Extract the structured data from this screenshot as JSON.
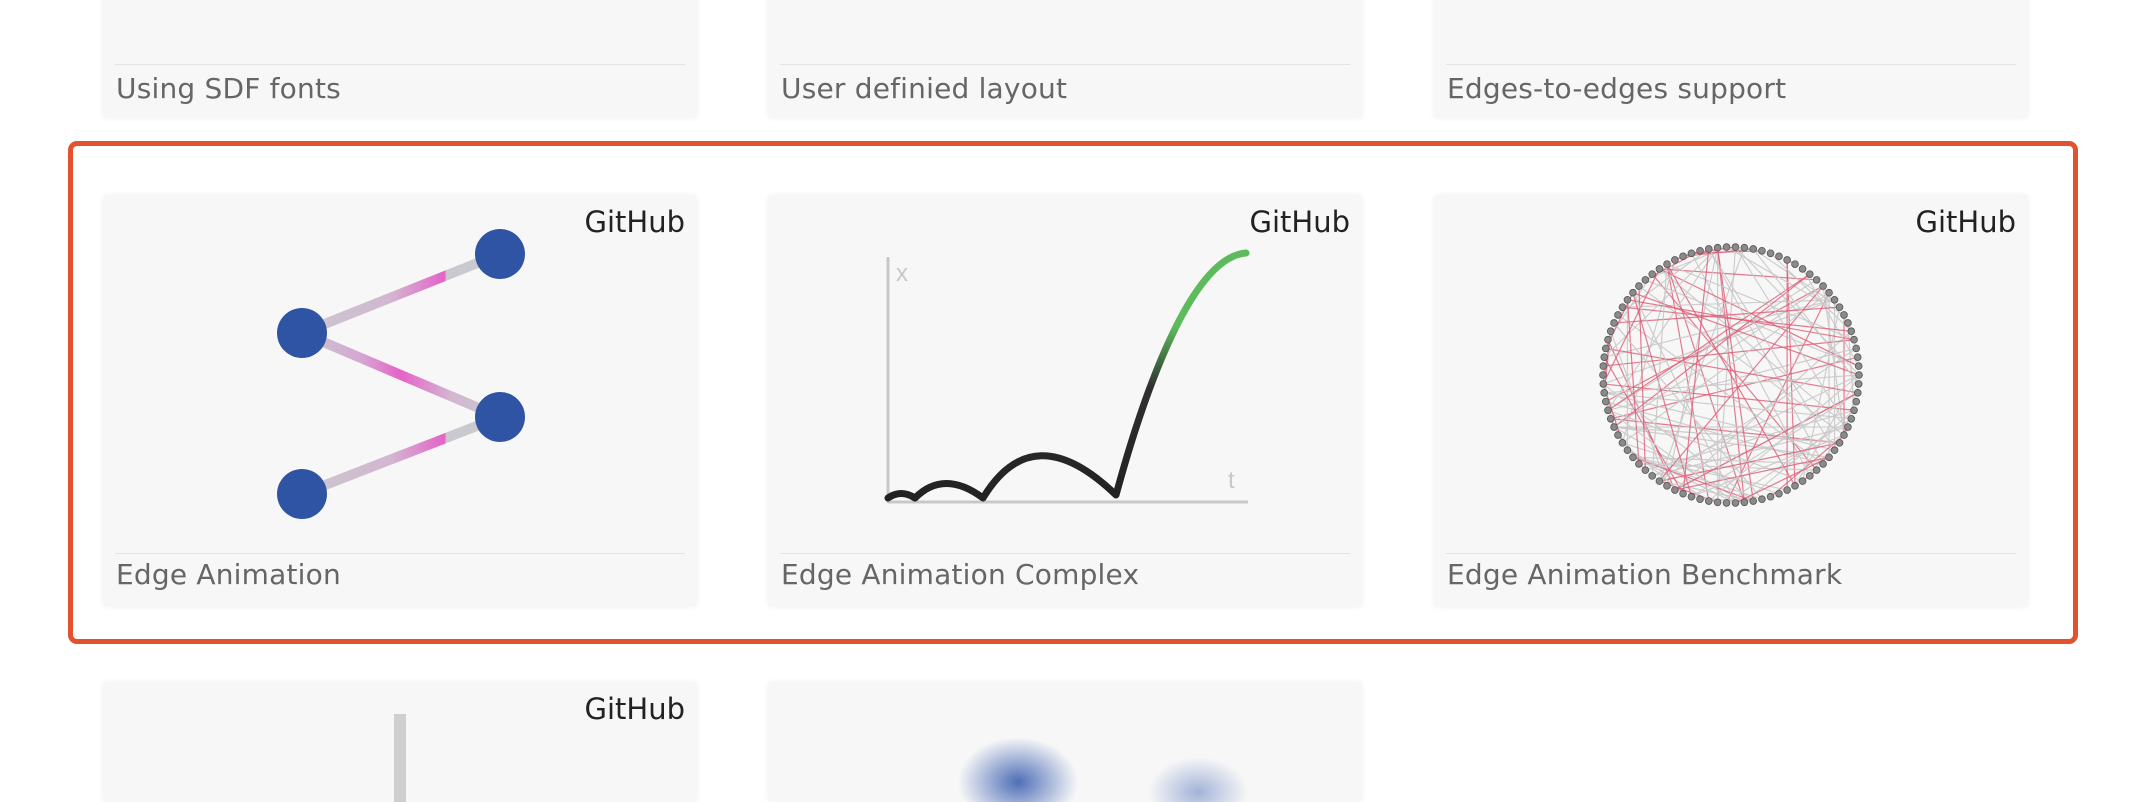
{
  "colors": {
    "highlight_border": "#e2522e",
    "card_background": "#f7f7f7",
    "caption_text": "#666666",
    "node_blue": "#2f54a3",
    "edge_pink": "#e463c8",
    "curve_green": "#5dbb5d"
  },
  "rows": {
    "top": [
      {
        "title": "Using SDF fonts"
      },
      {
        "title": "User definied layout"
      },
      {
        "title": "Edges-to-edges support"
      }
    ],
    "middle": [
      {
        "title": "Edge Animation",
        "link": "GitHub",
        "thumbnail": "graph-icon"
      },
      {
        "title": "Edge Animation Complex",
        "link": "GitHub",
        "thumbnail": "easing-curve-icon",
        "axis_x": "x",
        "axis_t": "t"
      },
      {
        "title": "Edge Animation Benchmark",
        "link": "GitHub",
        "thumbnail": "circle-graph-icon"
      }
    ],
    "bottom": [
      {
        "link": "GitHub"
      }
    ]
  }
}
